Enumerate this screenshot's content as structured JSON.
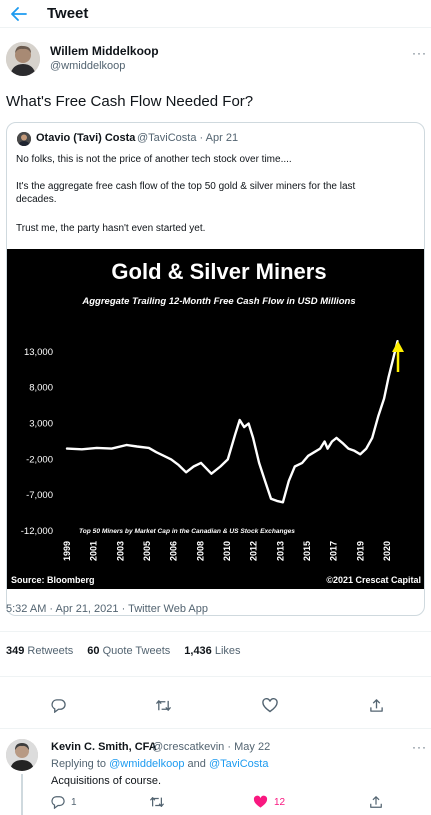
{
  "header": {
    "title": "Tweet",
    "back_icon": "arrow-left-icon"
  },
  "tweet": {
    "author_name": "Willem Middelkoop",
    "author_handle": "@wmiddelkoop",
    "text": "What's Free Cash Flow Needed For?",
    "timestamp": "5:32 AM · Apr 21, 2021 · Twitter Web App",
    "stats": {
      "retweets_count": "349",
      "retweets_label": "Retweets",
      "quotes_count": "60",
      "quotes_label": "Quote Tweets",
      "likes_count": "1,436",
      "likes_label": "Likes"
    }
  },
  "quote": {
    "author_name": "Otavio (Tavi) Costa",
    "author_handle": "@TaviCosta",
    "date": "Apr 21",
    "line1": "No folks, this is not the price of another tech stock over time....",
    "line2": "It's the aggregate free cash flow of the top 50 gold & silver miners for the last",
    "line3": "decades.",
    "line4": "Trust me, the party hasn't even started yet."
  },
  "chart_data": {
    "type": "line",
    "title": "Gold & Silver Miners",
    "subtitle": "Aggregate Trailing 12-Month Free Cash Flow in USD Millions",
    "note": "Top 50 Miners by Market Cap in the Canadian & US Stock Exchanges",
    "source": "Source: Bloomberg",
    "credit": "©2021 Crescat Capital",
    "xlabel": "",
    "ylabel": "",
    "ylim": [
      -12000,
      15500
    ],
    "xlim": [
      1999,
      2021.5
    ],
    "y_ticks": [
      "13,000",
      "8,000",
      "3,000",
      "-2,000",
      "-7,000",
      "-12,000"
    ],
    "y_tick_values": [
      13000,
      8000,
      3000,
      -2000,
      -7000,
      -12000
    ],
    "x_ticks": [
      "1999",
      "2001",
      "2003",
      "2005",
      "2006",
      "2008",
      "2010",
      "2012",
      "2013",
      "2015",
      "2017",
      "2019",
      "2020"
    ],
    "series": [
      {
        "x": [
          1999.0,
          2000.0,
          2001.0,
          2002.0,
          2003.0,
          2003.7,
          2004.5,
          2005.0,
          2005.5,
          2006.0,
          2006.5,
          2007.0,
          2007.5,
          2008.0,
          2008.7,
          2009.3,
          2009.8,
          2010.3,
          2010.6,
          2010.9,
          2011.2,
          2011.5,
          2011.9,
          2012.3,
          2012.7,
          2013.1,
          2013.5,
          2013.9,
          2014.3,
          2014.8,
          2015.2,
          2015.6,
          2016.0,
          2016.3,
          2016.5,
          2016.8,
          2017.1,
          2017.5,
          2017.9,
          2018.3,
          2018.7,
          2019.1,
          2019.5,
          2019.9,
          2020.3,
          2020.6,
          2020.9,
          2021.2
        ],
        "y": [
          -500,
          -600,
          -400,
          -500,
          0,
          -200,
          -400,
          -1000,
          -1500,
          -2000,
          -2800,
          -3800,
          -3000,
          -2500,
          -4000,
          -3000,
          -2000,
          1500,
          3500,
          2500,
          3000,
          1000,
          -2500,
          -5000,
          -7500,
          -7800,
          -8000,
          -5000,
          -3000,
          -2500,
          -1500,
          -1000,
          -500,
          500,
          -500,
          500,
          1000,
          300,
          -500,
          -800,
          -1300,
          -500,
          1000,
          4000,
          6500,
          9500,
          12000,
          14500
        ]
      }
    ],
    "annotations": [
      {
        "type": "arrow",
        "color": "#ffef00",
        "direction": "up"
      }
    ],
    "grid": false,
    "legend": "none",
    "colors": {
      "background": "#000000",
      "line": "#ffffff",
      "text": "#ffffff",
      "arrow": "#ffef00"
    }
  },
  "actions": {
    "reply_icon": "comment-icon",
    "retweet_icon": "retweet-icon",
    "like_icon": "heart-icon",
    "share_icon": "share-icon"
  },
  "reply": {
    "author_name": "Kevin C. Smith, CFA",
    "author_handle": "@crescatkevin",
    "date": "May 22",
    "replying_prefix": "Replying to",
    "replying_user1": "@wmiddelkoop",
    "replying_and": "and",
    "replying_user2": "@TaviCosta",
    "text": "Acquisitions of course.",
    "reply_count": "1",
    "like_count": "12"
  },
  "colors": {
    "accent": "#1d9bf0",
    "like": "#f91880",
    "muted": "#536471"
  }
}
